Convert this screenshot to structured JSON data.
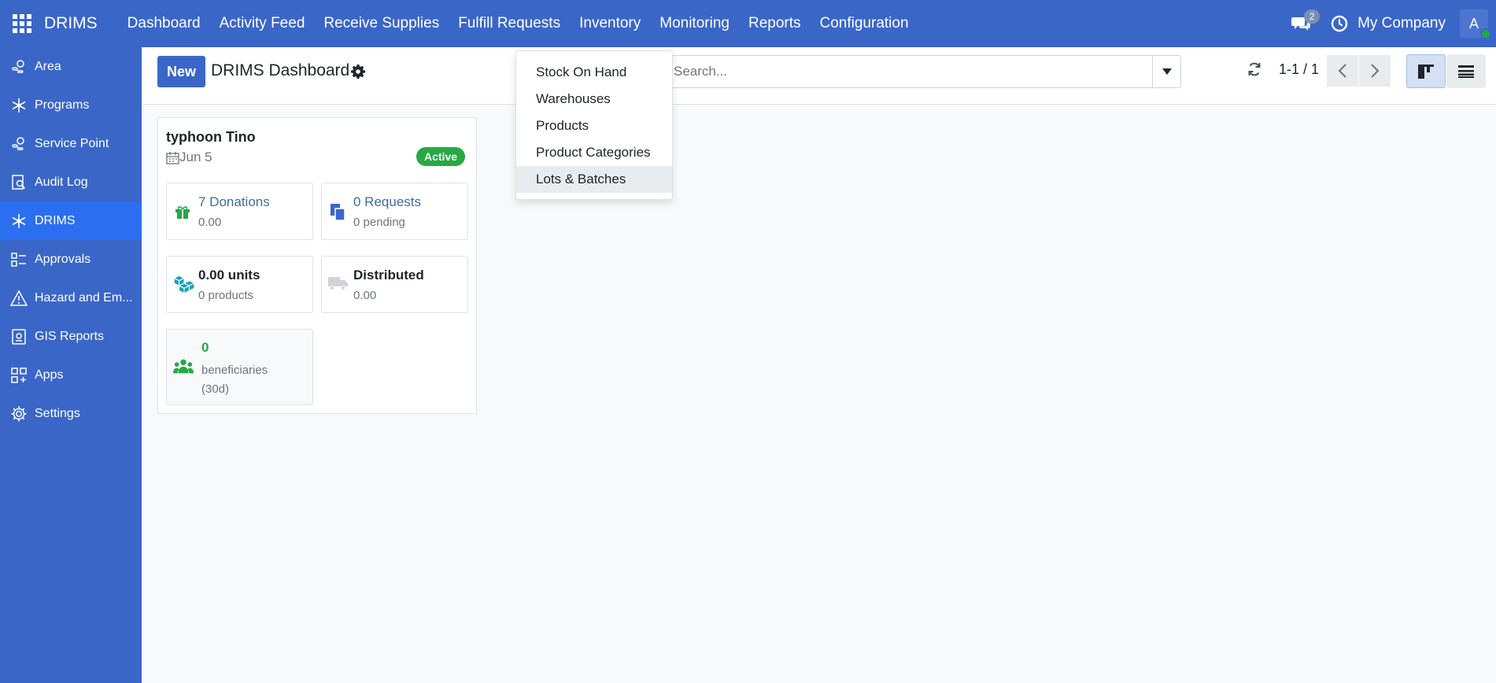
{
  "navbar": {
    "brand": "DRIMS",
    "menu": [
      "Dashboard",
      "Activity Feed",
      "Receive Supplies",
      "Fulfill Requests",
      "Inventory",
      "Monitoring",
      "Reports",
      "Configuration"
    ],
    "chat_count": "2",
    "company": "My Company",
    "avatar_letter": "A"
  },
  "sidebar": {
    "items": [
      {
        "label": "Area",
        "icon": "hand-icon"
      },
      {
        "label": "Programs",
        "icon": "snowflake-icon"
      },
      {
        "label": "Service Point",
        "icon": "hand-icon"
      },
      {
        "label": "Audit Log",
        "icon": "search-doc-icon"
      },
      {
        "label": "DRIMS",
        "icon": "snowflake-icon",
        "active": true
      },
      {
        "label": "Approvals",
        "icon": "checklist-icon"
      },
      {
        "label": "Hazard and Em...",
        "icon": "warning-icon"
      },
      {
        "label": "GIS Reports",
        "icon": "report-icon"
      },
      {
        "label": "Apps",
        "icon": "apps-icon"
      },
      {
        "label": "Settings",
        "icon": "gear-icon"
      }
    ]
  },
  "control": {
    "new_label": "New",
    "title": "DRIMS Dashboard",
    "search_placeholder": "Search...",
    "pager": "1-1 / 1"
  },
  "dropdown": {
    "items": [
      "Stock On Hand",
      "Warehouses",
      "Products",
      "Product Categories",
      "Lots & Batches"
    ],
    "hovered": "Lots & Batches"
  },
  "card": {
    "title": "typhoon Tino",
    "date": "Jun 5",
    "status": "Active",
    "donations_main": "7 Donations",
    "donations_sub": "0.00",
    "requests_main": "0 Requests",
    "requests_sub": "0 pending",
    "units_main": "0.00 units",
    "units_sub": "0 products",
    "distributed_main": "Distributed",
    "distributed_sub": "0.00",
    "beneficiaries_main": "0",
    "beneficiaries_sub": "beneficiaries (30d)"
  },
  "colors": {
    "primary": "#3a66c8",
    "active_sidebar": "#2b6ff0",
    "success": "#28a745",
    "link": "#3b6e9c"
  }
}
